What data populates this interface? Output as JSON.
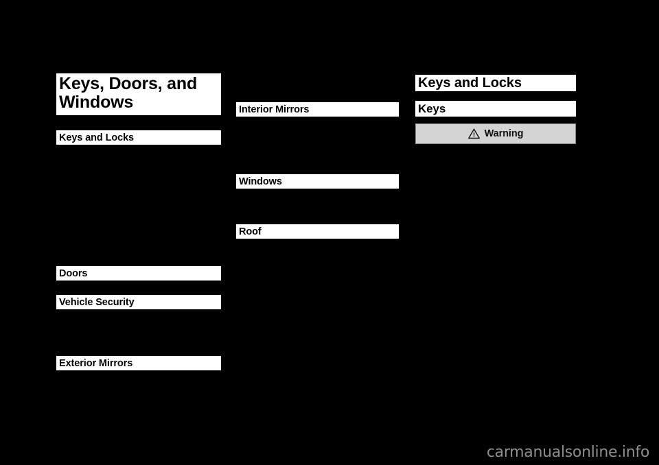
{
  "page": {
    "background_color": "#000000",
    "bar_color": "#ffffff",
    "warning_fill_color": "#d4d4d4",
    "warning_border_color": "#8a8a8a",
    "watermark_color": "#8e8e8e"
  },
  "chapter": {
    "title": "Keys, Doors, and Windows"
  },
  "columns": {
    "left": {
      "sections": [
        {
          "label": "Keys and Locks",
          "style": "section"
        },
        {
          "label": "Doors",
          "style": "section"
        },
        {
          "label": "Vehicle Security",
          "style": "section"
        },
        {
          "label": "Exterior Mirrors",
          "style": "section"
        }
      ]
    },
    "middle": {
      "sections": [
        {
          "label": "Interior Mirrors",
          "style": "section"
        },
        {
          "label": "Windows",
          "style": "section"
        },
        {
          "label": "Roof",
          "style": "section"
        }
      ]
    },
    "right": {
      "heading": "Keys and Locks",
      "subheading": "Keys",
      "warning": {
        "icon": "warning-triangle-icon",
        "label": "Warning"
      }
    }
  },
  "watermark": {
    "text": "carmanualsonline.info"
  }
}
